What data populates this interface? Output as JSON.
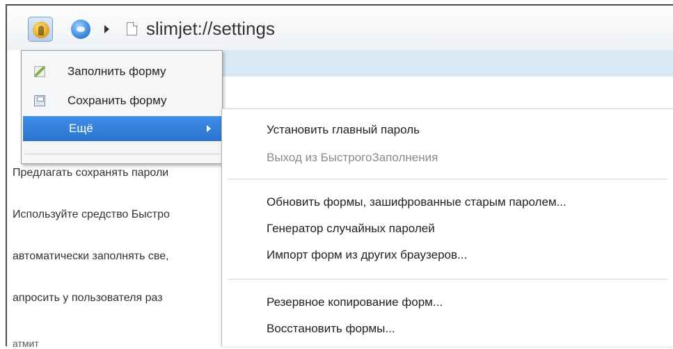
{
  "browser": {
    "address": "slimjet://settings"
  },
  "autofill_menu": {
    "items": [
      {
        "label": "Заполнить форму",
        "icon": "form-fill-icon"
      },
      {
        "label": "Сохранить форму",
        "icon": "form-save-icon"
      },
      {
        "label": "Ещё",
        "icon": "submenu-arrow-icon"
      }
    ]
  },
  "more_submenu": {
    "groups": [
      [
        {
          "label": "Установить главный пароль",
          "enabled": true
        },
        {
          "label": "Выход из БыстрогоЗаполнения",
          "enabled": false
        }
      ],
      [
        {
          "label": "Обновить формы, зашифрованные старым паролем...",
          "enabled": true
        },
        {
          "label": "Генератор случайных паролей",
          "enabled": true
        },
        {
          "label": "Импорт форм из других браузеров...",
          "enabled": true
        }
      ],
      [
        {
          "label": "Резервное копирование форм...",
          "enabled": true
        },
        {
          "label": "Восстановить формы...",
          "enabled": true
        }
      ]
    ]
  },
  "settings_background": {
    "lines": [
      "Предлагать сохранять пароли",
      "Используйте средство Быстро",
      "автоматически заполнять све,",
      "апросить у пользователя раз"
    ],
    "bottom_text": "атмит"
  },
  "colors": {
    "menu_highlight": "#2a74d0",
    "page_header": "#d8e8f4",
    "disabled_text": "#8a8a8a"
  }
}
